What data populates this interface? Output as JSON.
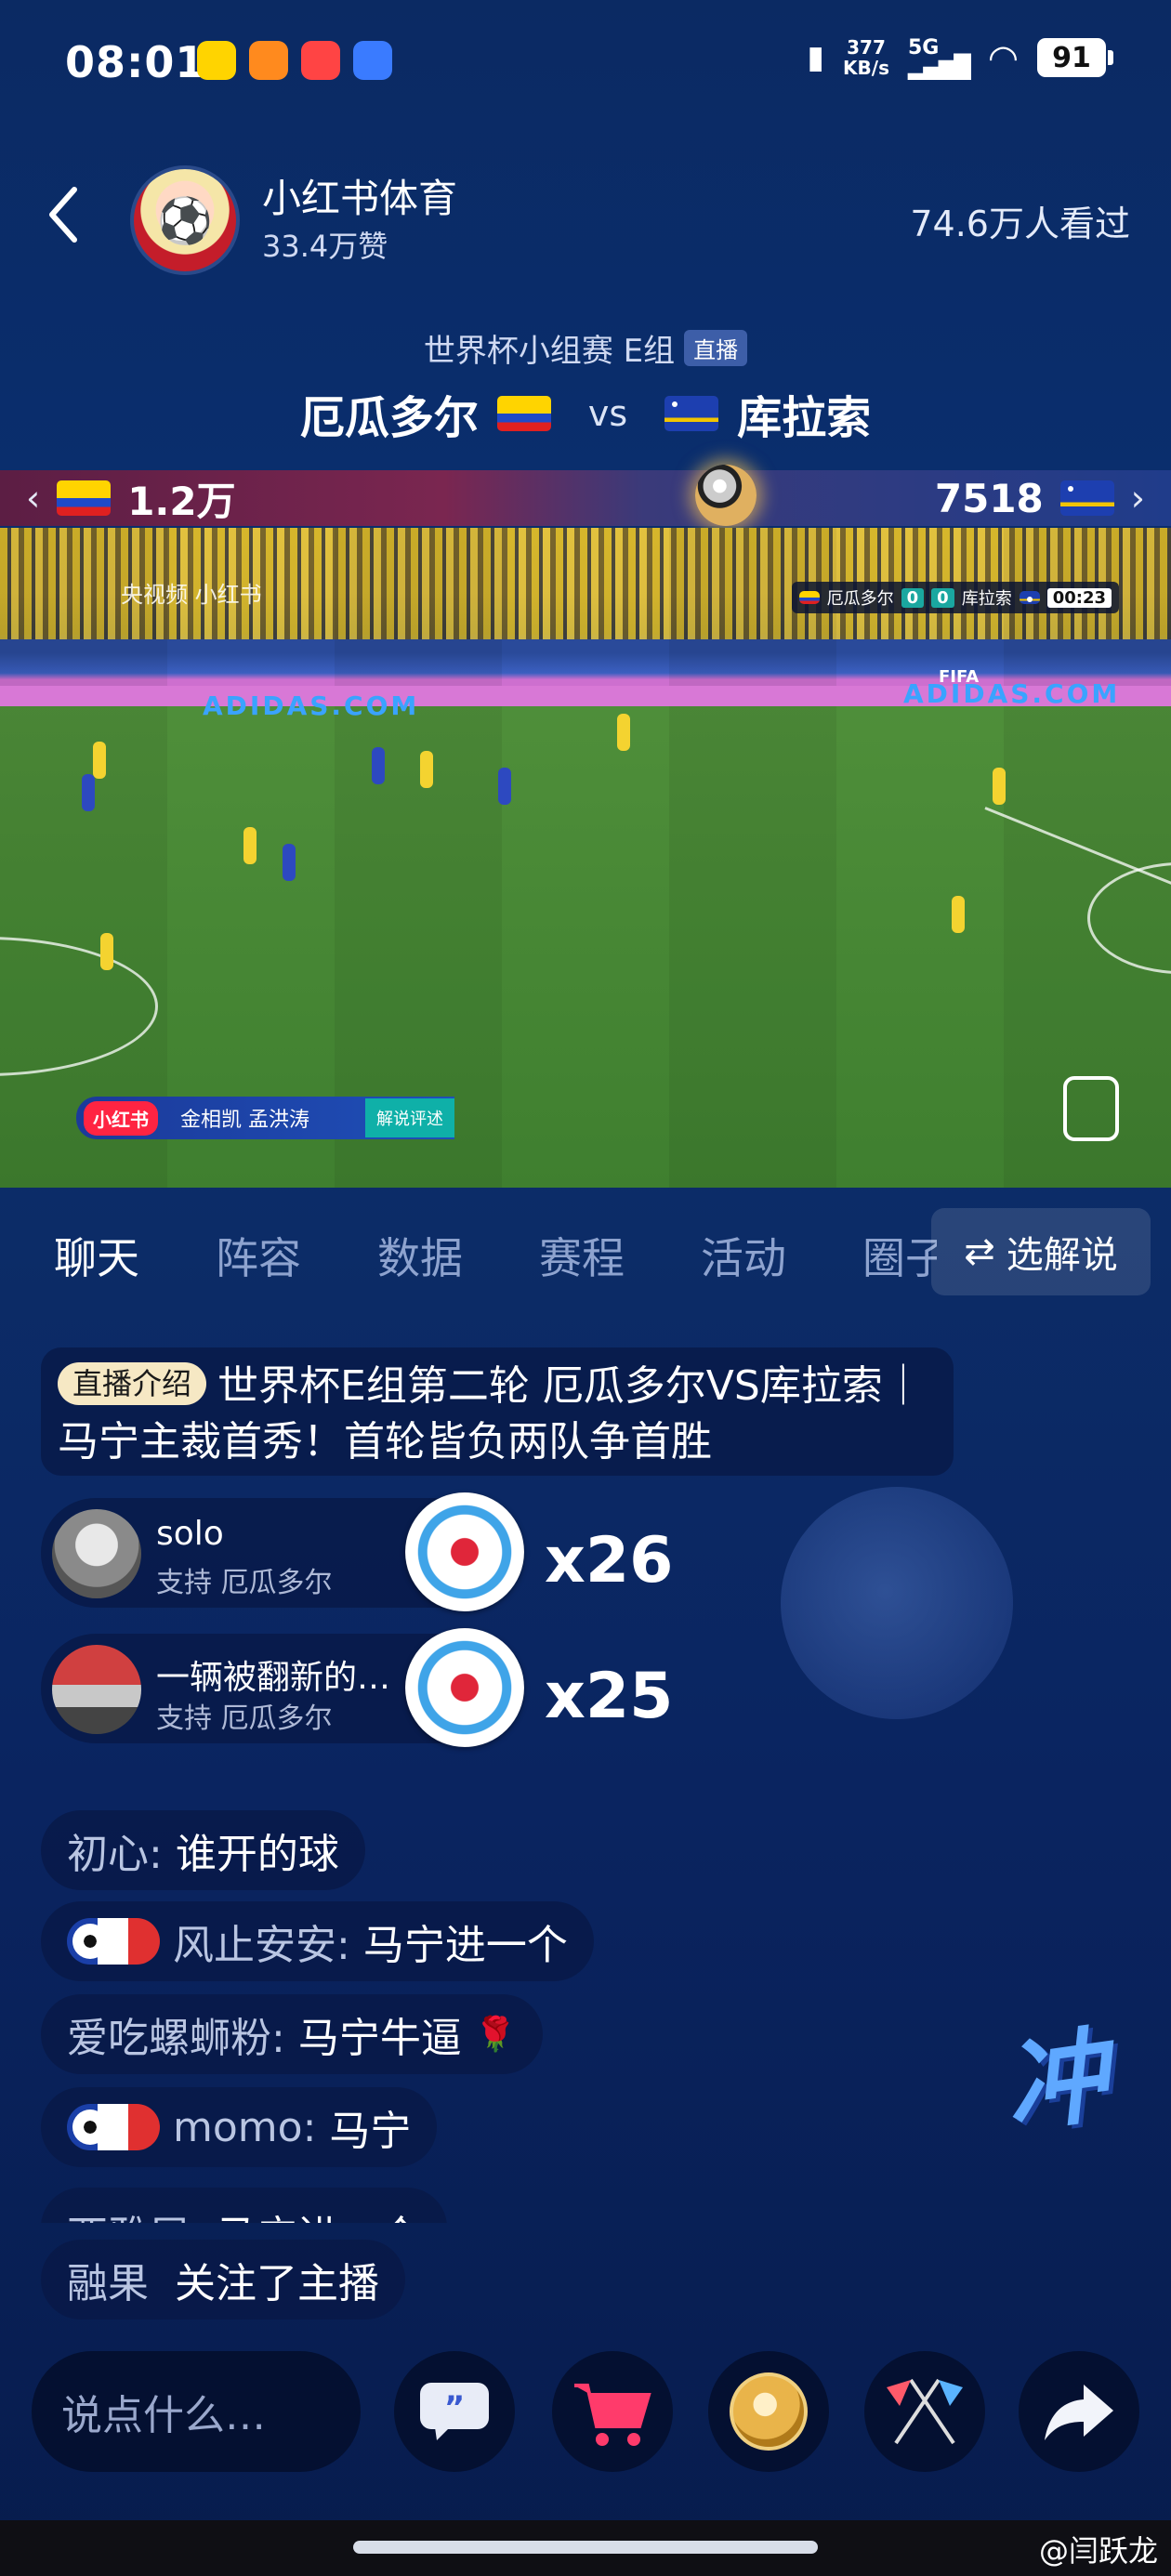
{
  "status_bar": {
    "time": "08:01",
    "net_speed_value": "377",
    "net_speed_unit": "KB/s",
    "network": "5G",
    "battery": "91"
  },
  "header": {
    "back_icon": "chevron-left-icon",
    "host_name": "小红书体育",
    "host_likes": "33.4万赞",
    "viewers": "74.6万人看过"
  },
  "match": {
    "subtitle": "世界杯小组赛 E组",
    "live_badge": "直播",
    "team_home": "厄瓜多尔",
    "vs": "vs",
    "team_away": "库拉索"
  },
  "support": {
    "home_count": "1.2万",
    "away_count": "7518"
  },
  "video": {
    "watermark": "央视频 小红书",
    "scorebug_home": "厄瓜多尔",
    "scorebug_home_score": "0",
    "scorebug_away_score": "0",
    "scorebug_away": "库拉索",
    "scorebug_time": "00:23",
    "ad_text": "ADIDAS.COM",
    "ad_text_2": "ADIDAS.COM",
    "fifa": "FIFA",
    "commentator_logo": "小红书",
    "commentators": "金相凯   孟洪涛",
    "commentator_label": "解说评述"
  },
  "tabs": {
    "items": [
      "聊天",
      "阵容",
      "数据",
      "赛程",
      "活动",
      "圈子"
    ],
    "active_index": 0,
    "choose_commentator": "选解说"
  },
  "chat": {
    "intro_tag": "直播介绍",
    "intro_text": "世界杯E组第二轮 厄瓜多尔VS库拉索｜马宁主裁首秀！首轮皆负两队争首胜",
    "gifts": [
      {
        "name": "solo",
        "sub": "支持 厄瓜多尔",
        "count": "x26"
      },
      {
        "name": "一辆被翻新的…",
        "sub": "支持 厄瓜多尔",
        "count": "x25"
      }
    ],
    "messages": [
      {
        "name": "初心:",
        "text": "谁开的球",
        "badge": false,
        "emoji": ""
      },
      {
        "name": "风止安安:",
        "text": "马宁进一个",
        "badge": true,
        "emoji": ""
      },
      {
        "name": "爱吃螺蛳粉:",
        "text": "马宁牛逼",
        "badge": false,
        "emoji": "🌹"
      },
      {
        "name": "momo:",
        "text": "马宁",
        "badge": true,
        "emoji": ""
      },
      {
        "name": "西雅居:",
        "text": "马宁进一个",
        "badge": false,
        "emoji": ""
      }
    ],
    "follow_name": "融果",
    "follow_text": "关注了主播",
    "chong": "冲"
  },
  "bottom": {
    "input_placeholder": "说点什么…",
    "buttons": [
      "comment-icon",
      "shopping-cart-icon",
      "football-icon",
      "crossed-flags-icon",
      "share-icon"
    ],
    "watermark": "@闫跃龙"
  },
  "colors": {
    "background": "#0a2e6e",
    "tab_inactive": "#8ea3cf",
    "accent_teal": "#1aa7a0",
    "brand_red": "#ff2442"
  }
}
